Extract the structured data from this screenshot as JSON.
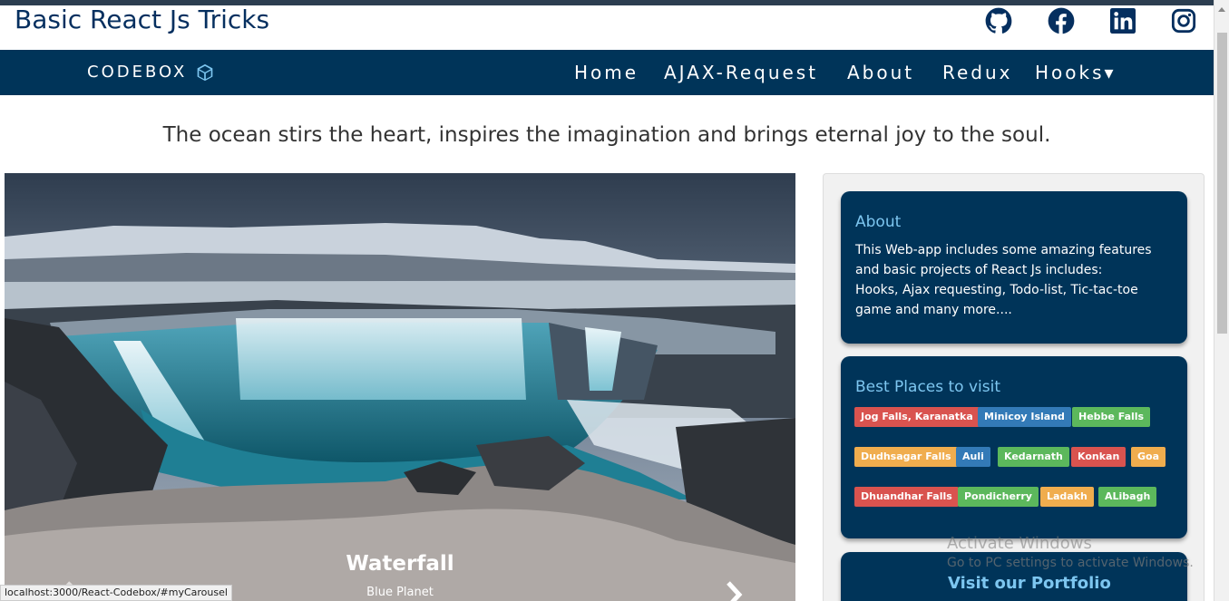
{
  "header": {
    "title": "Basic React Js Tricks",
    "social": [
      "github-icon",
      "facebook-icon",
      "linkedin-icon",
      "instagram-icon"
    ]
  },
  "navbar": {
    "brand": "CODEBOX",
    "items": [
      "Home",
      "AJAX-Request",
      "About",
      "Redux",
      "Hooks▾"
    ]
  },
  "tagline": "The ocean stirs the heart, inspires the imagination and brings eternal joy to the soul.",
  "carousel": {
    "caption_title": "Waterfall",
    "caption_sub": "Blue Planet"
  },
  "status_url": "localhost:3000/React-Codebox/#myCarousel",
  "sidebar": {
    "about": {
      "title": "About",
      "lines": [
        "This Web-app includes some amazing features",
        "and basic projects of React Js includes:",
        "Hooks, Ajax requesting, Todo-list, Tic-tac-toe",
        "game and many more...."
      ]
    },
    "places": {
      "title": "Best Places to visit",
      "tags": [
        {
          "label": "Jog Falls, Karanatka",
          "color": "red"
        },
        {
          "label": "Minicoy Island",
          "color": "blue"
        },
        {
          "label": "Hebbe Falls",
          "color": "green"
        },
        {
          "label": "Dudhsagar Falls",
          "color": "orange"
        },
        {
          "label": "Auli",
          "color": "blue"
        },
        {
          "label": "Kedarnath",
          "color": "green"
        },
        {
          "label": "Konkan",
          "color": "red"
        },
        {
          "label": "Goa",
          "color": "orange"
        },
        {
          "label": "Dhuandhar Falls",
          "color": "red"
        },
        {
          "label": "Pondicherry",
          "color": "green"
        },
        {
          "label": "Ladakh",
          "color": "orange"
        },
        {
          "label": "ALibagh",
          "color": "green"
        }
      ]
    },
    "portfolio": {
      "title": "Visit our Portfolio"
    }
  },
  "watermark": {
    "line1": "Activate Windows",
    "line2": "Go to PC settings to activate Windows."
  },
  "colors": {
    "navbar": "#003459",
    "card": "#003459",
    "card_heading": "#7dc6f0"
  }
}
